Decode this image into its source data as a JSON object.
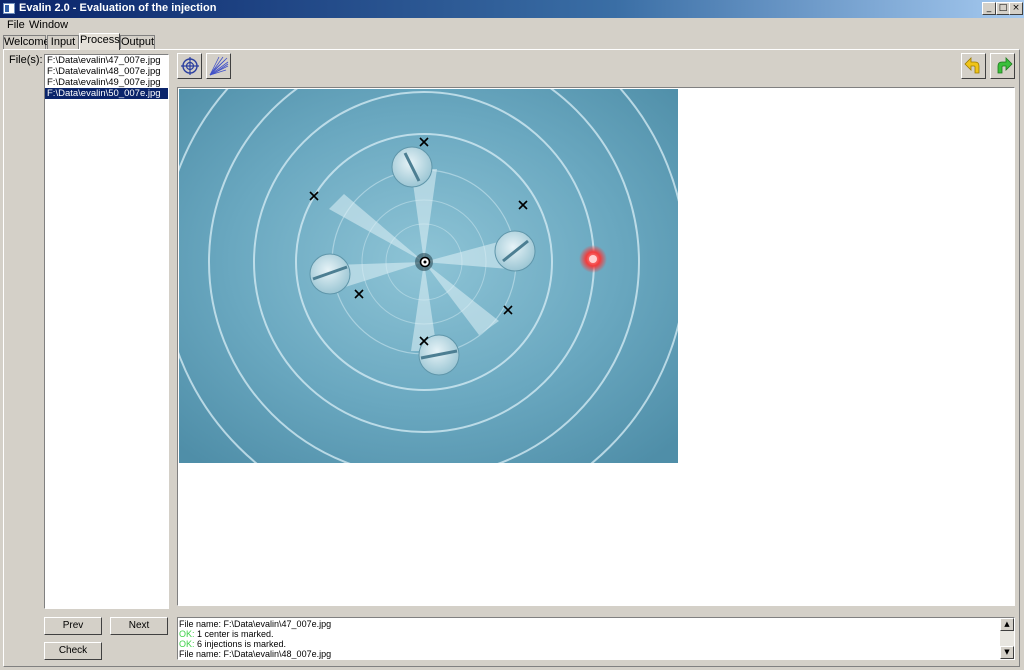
{
  "window": {
    "title": "Evalin 2.0 - Evaluation of the injection",
    "controls": {
      "minimize": "_",
      "maximize": "□",
      "close": "×"
    }
  },
  "menu": [
    "File",
    "Window"
  ],
  "tabs": [
    {
      "label": "Welcome",
      "active": false
    },
    {
      "label": "Input",
      "active": false
    },
    {
      "label": "Process",
      "active": true
    },
    {
      "label": "Output",
      "active": false
    }
  ],
  "files": {
    "label": "File(s):",
    "items": [
      "F:\\Data\\evalin\\47_007e.jpg",
      "F:\\Data\\evalin\\48_007e.jpg",
      "F:\\Data\\evalin\\49_007e.jpg",
      "F:\\Data\\evalin\\50_007e.jpg"
    ],
    "selected_index": 3
  },
  "buttons": {
    "prev": "Prev",
    "next": "Next",
    "check": "Check"
  },
  "toolbar": {
    "left_tools": [
      "crosshair-icon",
      "spray-pattern-icon"
    ],
    "right_tools": [
      "undo-arrow-icon",
      "redo-arrow-icon"
    ],
    "colors": {
      "undo": "#f0c419",
      "redo": "#3bbf3b"
    }
  },
  "log": {
    "lines": [
      {
        "prefix": "",
        "text": "File name: F:\\Data\\evalin\\47_007e.jpg"
      },
      {
        "prefix": "OK:",
        "text": " 1 center is marked."
      },
      {
        "prefix": "OK:",
        "text": " 6 injections is marked."
      },
      {
        "prefix": "",
        "text": "File name: F:\\Data\\evalin\\48_007e.jpg"
      }
    ]
  }
}
